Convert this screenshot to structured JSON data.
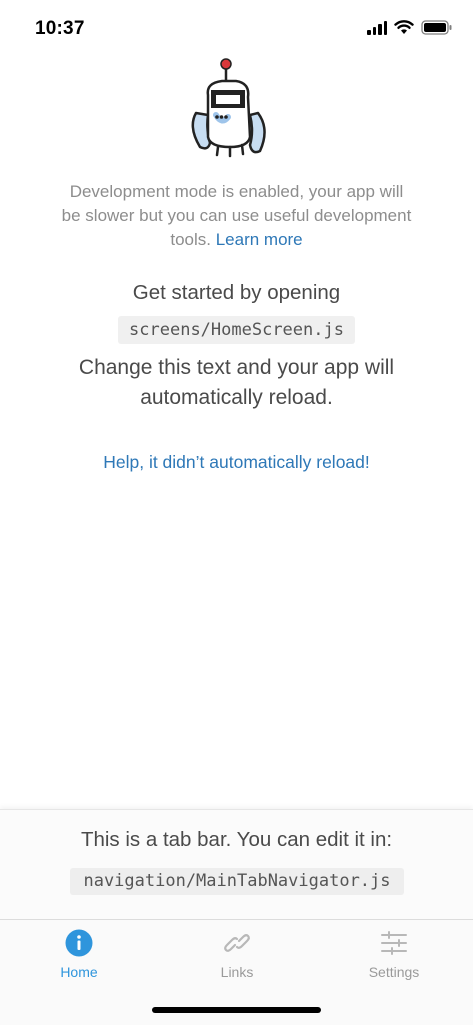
{
  "status_bar": {
    "time": "10:37"
  },
  "dev_notice": {
    "text": "Development mode is enabled, your app will be slower but you can use useful development tools. ",
    "link": "Learn more"
  },
  "home": {
    "get_started": "Get started by opening",
    "file_path": "screens/HomeScreen.js",
    "change_text": "Change this text and your app will automatically reload.",
    "help_link": "Help, it didn’t automatically reload!"
  },
  "tab_bar_info": {
    "text": "This is a tab bar. You can edit it in:",
    "file_path": "navigation/MainTabNavigator.js"
  },
  "tabs": [
    {
      "label": "Home",
      "icon": "info-icon",
      "active": true
    },
    {
      "label": "Links",
      "icon": "link-icon",
      "active": false
    },
    {
      "label": "Settings",
      "icon": "sliders-icon",
      "active": false
    }
  ],
  "colors": {
    "accent": "#2f95dc",
    "link": "#2e78b7",
    "inactive": "#9a9a9a"
  }
}
